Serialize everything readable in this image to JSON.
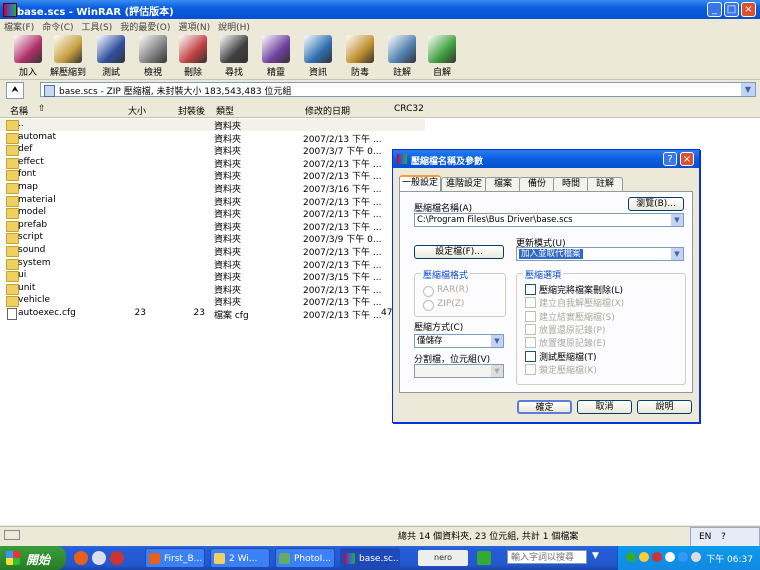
{
  "window": {
    "title": "base.scs - WinRAR (評估版本)"
  },
  "menu": [
    "檔案(F)",
    "命令(C)",
    "工具(S)",
    "我的最愛(O)",
    "選項(N)",
    "說明(H)"
  ],
  "toolbar": [
    {
      "label": "加入",
      "icon": "add-archive-icon",
      "color": "#b0306a"
    },
    {
      "label": "解壓縮到",
      "icon": "extract-to-icon",
      "color": "#c8a040"
    },
    {
      "label": "測試",
      "icon": "test-icon",
      "color": "#3050a0"
    },
    {
      "label": "檢視",
      "icon": "view-icon",
      "color": "#808080"
    },
    {
      "label": "刪除",
      "icon": "delete-icon",
      "color": "#c04040"
    },
    {
      "label": "尋找",
      "icon": "find-icon",
      "color": "#404040"
    },
    {
      "label": "精靈",
      "icon": "wizard-icon",
      "color": "#7040a0"
    },
    {
      "label": "資訊",
      "icon": "info-icon",
      "color": "#3070b0"
    },
    {
      "label": "防毒",
      "icon": "antivirus-icon",
      "color": "#c09030"
    },
    {
      "label": "註解",
      "icon": "comment-icon",
      "color": "#5080b0"
    },
    {
      "label": "自解",
      "icon": "sfx-icon",
      "color": "#40a040"
    }
  ],
  "address": "base.scs - ZIP 壓縮檔, 未封裝大小 183,543,483 位元組",
  "columns": {
    "name": "名稱",
    "size": "大小",
    "packed": "封裝後",
    "type": "類型",
    "modified": "修改的日期",
    "crc": "CRC32"
  },
  "files": [
    {
      "name": "..",
      "size": "",
      "packed": "",
      "type": "資料夾",
      "modified": "",
      "crc": "",
      "kind": "folder"
    },
    {
      "name": "automat",
      "size": "",
      "packed": "",
      "type": "資料夾",
      "modified": "2007/2/13 下午 ...",
      "crc": "",
      "kind": "folder"
    },
    {
      "name": "def",
      "size": "",
      "packed": "",
      "type": "資料夾",
      "modified": "2007/3/7 下午 0...",
      "crc": "",
      "kind": "folder"
    },
    {
      "name": "effect",
      "size": "",
      "packed": "",
      "type": "資料夾",
      "modified": "2007/2/13 下午 ...",
      "crc": "",
      "kind": "folder"
    },
    {
      "name": "font",
      "size": "",
      "packed": "",
      "type": "資料夾",
      "modified": "2007/2/13 下午 ...",
      "crc": "",
      "kind": "folder"
    },
    {
      "name": "map",
      "size": "",
      "packed": "",
      "type": "資料夾",
      "modified": "2007/3/16 下午 ...",
      "crc": "",
      "kind": "folder"
    },
    {
      "name": "material",
      "size": "",
      "packed": "",
      "type": "資料夾",
      "modified": "2007/2/13 下午 ...",
      "crc": "",
      "kind": "folder"
    },
    {
      "name": "model",
      "size": "",
      "packed": "",
      "type": "資料夾",
      "modified": "2007/2/13 下午 ...",
      "crc": "",
      "kind": "folder"
    },
    {
      "name": "prefab",
      "size": "",
      "packed": "",
      "type": "資料夾",
      "modified": "2007/2/13 下午 ...",
      "crc": "",
      "kind": "folder"
    },
    {
      "name": "script",
      "size": "",
      "packed": "",
      "type": "資料夾",
      "modified": "2007/3/9 下午 0...",
      "crc": "",
      "kind": "folder"
    },
    {
      "name": "sound",
      "size": "",
      "packed": "",
      "type": "資料夾",
      "modified": "2007/2/13 下午 ...",
      "crc": "",
      "kind": "folder"
    },
    {
      "name": "system",
      "size": "",
      "packed": "",
      "type": "資料夾",
      "modified": "2007/2/13 下午 ...",
      "crc": "",
      "kind": "folder"
    },
    {
      "name": "ui",
      "size": "",
      "packed": "",
      "type": "資料夾",
      "modified": "2007/3/15 下午 ...",
      "crc": "",
      "kind": "folder"
    },
    {
      "name": "unit",
      "size": "",
      "packed": "",
      "type": "資料夾",
      "modified": "2007/2/13 下午 ...",
      "crc": "",
      "kind": "folder"
    },
    {
      "name": "vehicle",
      "size": "",
      "packed": "",
      "type": "資料夾",
      "modified": "2007/2/13 下午 ...",
      "crc": "",
      "kind": "folder"
    },
    {
      "name": "autoexec.cfg",
      "size": "23",
      "packed": "23",
      "type": "檔案 cfg",
      "modified": "2007/2/13 下午 ...",
      "crc": "47",
      "kind": "file"
    }
  ],
  "status": "總共 14 個資料夾, 23 位元組, 共計 1 個檔案",
  "dialog": {
    "title": "壓縮檔名稱及參數",
    "tabs": [
      "一般設定",
      "進階設定",
      "檔案",
      "備份",
      "時間",
      "註解"
    ],
    "archive_name_label": "壓縮檔名稱(A)",
    "browse_button": "瀏覽(B)...",
    "archive_path": "C:\\Program Files\\Bus Driver\\base.scs",
    "profiles_button": "設定檔(F)...",
    "update_mode_label": "更新模式(U)",
    "update_mode_value": "加入並取代檔案",
    "format_group": "壓縮檔格式",
    "format_rar": "RAR(R)",
    "format_zip": "ZIP(Z)",
    "method_label": "壓縮方式(C)",
    "method_value": "僅儲存",
    "split_label": "分割檔，位元組(V)",
    "split_value": "",
    "options_group": "壓縮選項",
    "options": [
      {
        "label": "壓縮完將檔案刪除(L)",
        "enabled": true
      },
      {
        "label": "建立自我解壓縮檔(X)",
        "enabled": false
      },
      {
        "label": "建立結實壓縮檔(S)",
        "enabled": false
      },
      {
        "label": "放置還原記錄(P)",
        "enabled": false
      },
      {
        "label": "放置復原記錄(E)",
        "enabled": false
      },
      {
        "label": "測試壓縮檔(T)",
        "enabled": true
      },
      {
        "label": "鎖定壓縮檔(K)",
        "enabled": false
      }
    ],
    "ok": "確定",
    "cancel": "取消",
    "help": "說明"
  },
  "langbar": {
    "lang": "EN"
  },
  "taskbar": {
    "start": "開始",
    "tasks": [
      {
        "label": "First_B..."
      },
      {
        "label": "2 Wi..."
      },
      {
        "label": "PhotoI..."
      },
      {
        "label": "base.sc..."
      }
    ],
    "search_placeholder": "輸入字詞以搜尋",
    "clock": "下午 06:37"
  }
}
